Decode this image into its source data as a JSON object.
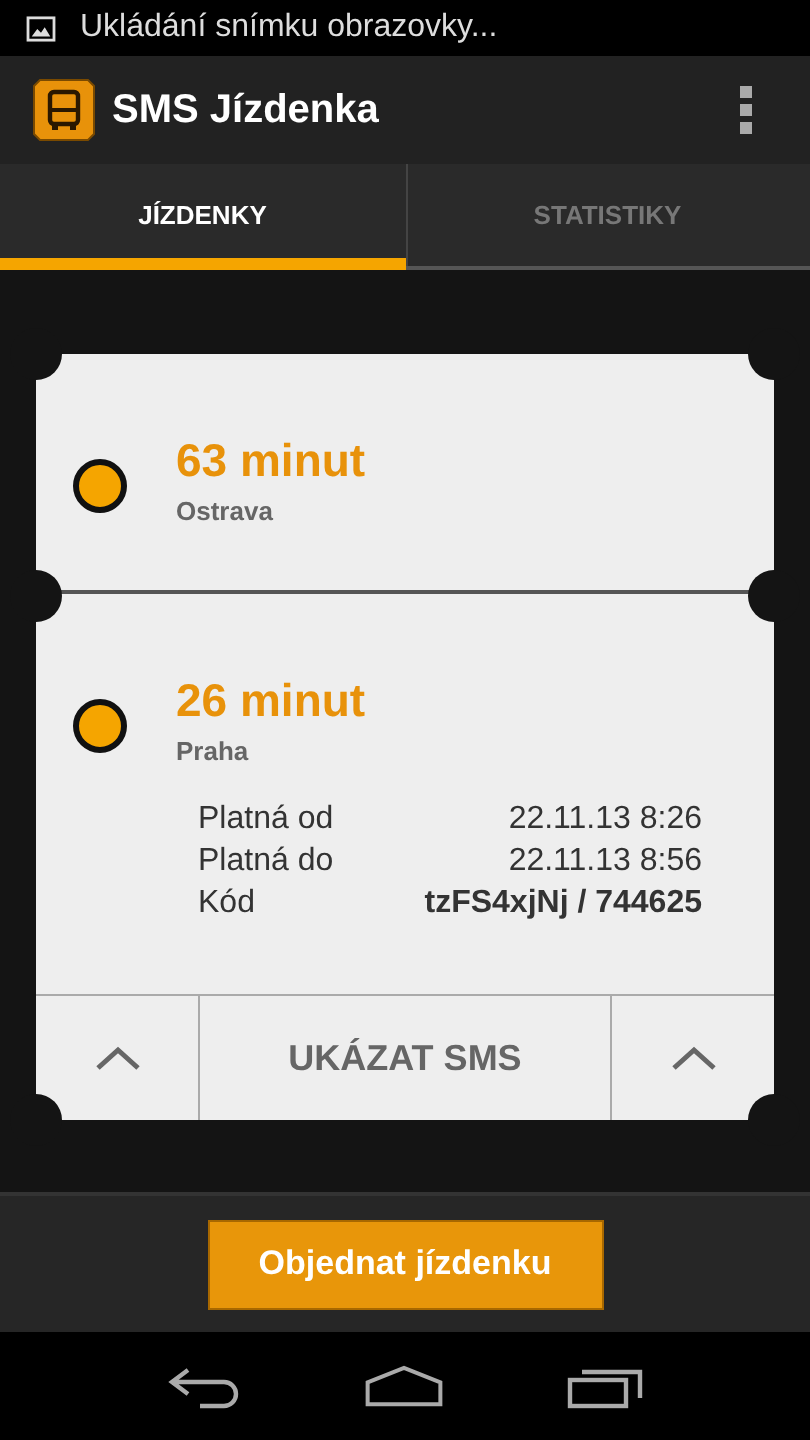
{
  "status_bar": {
    "notification": "Ukládání snímku obrazovky..."
  },
  "action_bar": {
    "title": "SMS Jízdenka"
  },
  "tabs": [
    {
      "label": "JÍZDENKY",
      "selected": true
    },
    {
      "label": "STATISTIKY",
      "selected": false
    }
  ],
  "tickets": [
    {
      "duration": "63 minut",
      "city": "Ostrava",
      "expanded": false
    },
    {
      "duration": "26 minut",
      "city": "Praha",
      "expanded": true,
      "details": [
        {
          "label": "Platná od",
          "value": "22.11.13 8:26",
          "kind": "plain"
        },
        {
          "label": "Platná do",
          "value": "22.11.13 8:56",
          "kind": "plain"
        },
        {
          "label": "Kód",
          "value": "tzFS4xjNj / 744625",
          "kind": "code"
        }
      ]
    }
  ],
  "ticket_footer": {
    "button": "UKÁZAT SMS"
  },
  "order_button": "Objednat jízdenku"
}
